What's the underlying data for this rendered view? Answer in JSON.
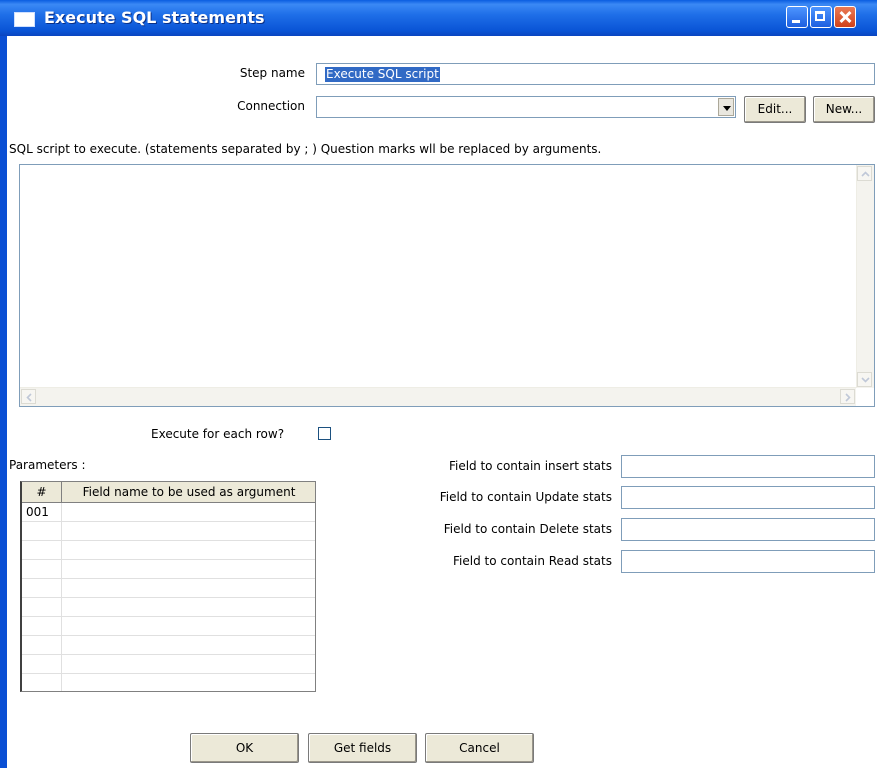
{
  "window": {
    "title": "Execute SQL statements"
  },
  "form": {
    "step_name_label": "Step name",
    "step_name_value": "Execute SQL script",
    "connection_label": "Connection",
    "connection_value": "",
    "edit_button": "Edit...",
    "new_button": "New...",
    "sql_label": "SQL script to execute. (statements separated by ; ) Question marks wll be replaced by arguments.",
    "sql_value": "",
    "execute_each_row_label": "Execute for each row?",
    "execute_each_row_checked": false,
    "parameters_label": "Parameters :"
  },
  "parameters_table": {
    "columns": [
      "#",
      "Field name to be used as argument"
    ],
    "rows": [
      {
        "num": "001",
        "field": ""
      },
      {
        "num": "",
        "field": ""
      },
      {
        "num": "",
        "field": ""
      },
      {
        "num": "",
        "field": ""
      },
      {
        "num": "",
        "field": ""
      },
      {
        "num": "",
        "field": ""
      },
      {
        "num": "",
        "field": ""
      },
      {
        "num": "",
        "field": ""
      },
      {
        "num": "",
        "field": ""
      }
    ]
  },
  "stats": {
    "insert_label": "Field to contain insert stats",
    "update_label": "Field to contain Update stats",
    "delete_label": "Field to contain Delete stats",
    "read_label": "Field to contain Read stats",
    "insert_value": "",
    "update_value": "",
    "delete_value": "",
    "read_value": ""
  },
  "buttons": {
    "ok": "OK",
    "get_fields": "Get fields",
    "cancel": "Cancel"
  },
  "colors": {
    "titlebar": "#0a54d6",
    "selection": "#316ac5",
    "button_face": "#ece9d8"
  }
}
